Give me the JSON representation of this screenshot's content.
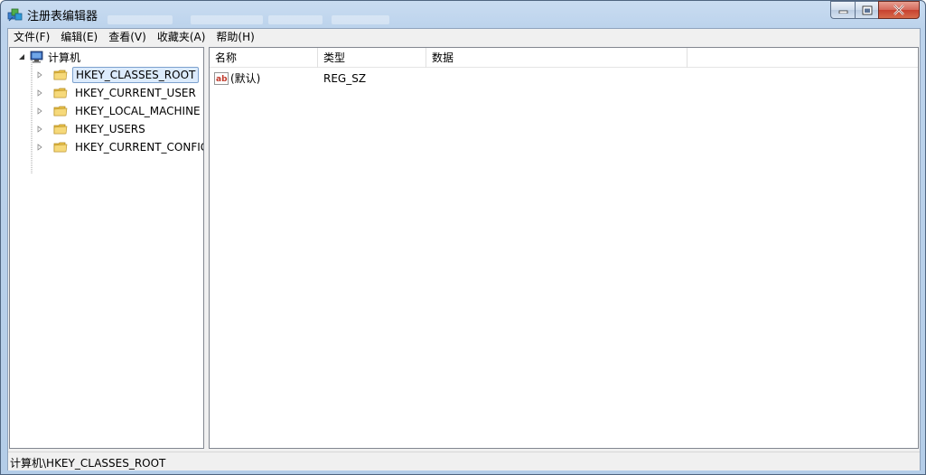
{
  "window": {
    "title": "注册表编辑器"
  },
  "menu": {
    "items": [
      "文件(F)",
      "编辑(E)",
      "查看(V)",
      "收藏夹(A)",
      "帮助(H)"
    ]
  },
  "tree": {
    "root": "计算机",
    "keys": [
      "HKEY_CLASSES_ROOT",
      "HKEY_CURRENT_USER",
      "HKEY_LOCAL_MACHINE",
      "HKEY_USERS",
      "HKEY_CURRENT_CONFIG"
    ],
    "selected_key": "HKEY_CLASSES_ROOT"
  },
  "list": {
    "columns": [
      "名称",
      "类型",
      "数据"
    ],
    "rows": [
      {
        "name": "(默认)",
        "type": "REG_SZ",
        "data": "",
        "icon": "string-value-icon"
      }
    ]
  },
  "status": {
    "path": "计算机\\HKEY_CLASSES_ROOT"
  },
  "colors": {
    "selection_fill": "#dcebfc",
    "selection_border": "#7da2ce",
    "close_button": "#c7412f",
    "folder": "#e8c04a"
  }
}
